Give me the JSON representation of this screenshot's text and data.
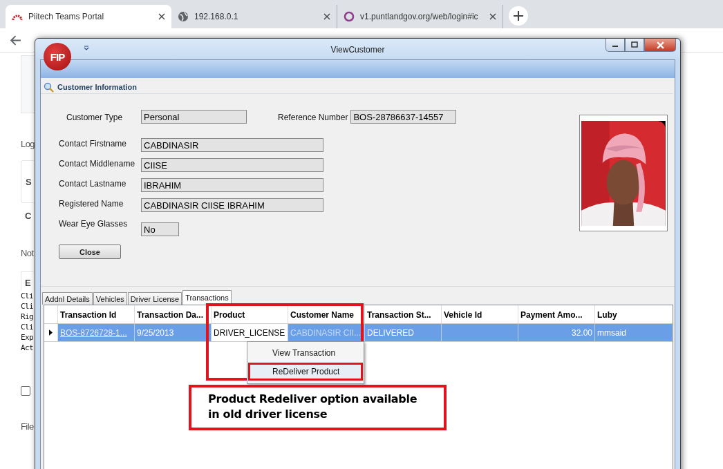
{
  "browser": {
    "tabs": [
      {
        "title": "Piitech Teams Portal",
        "selected": true
      },
      {
        "title": "192.168.0.1",
        "selected": false
      },
      {
        "title": "v1.puntlandgov.org/web/login#ic",
        "selected": false
      }
    ]
  },
  "background_page": {
    "lines": [
      {
        "kind": "panel"
      },
      {
        "kind": "plain",
        "text": "Log"
      },
      {
        "kind": "card",
        "text": "S"
      },
      {
        "kind": "bold",
        "text": "C"
      },
      {
        "kind": "plain",
        "text": "Not"
      },
      {
        "kind": "tab",
        "text": "E"
      },
      {
        "kind": "code",
        "text": "Cli"
      },
      {
        "kind": "code",
        "text": "Cli"
      },
      {
        "kind": "code",
        "text": "Rig"
      },
      {
        "kind": "code",
        "text": "Cli"
      },
      {
        "kind": "code",
        "text": "Exp"
      },
      {
        "kind": "code",
        "text": "Act"
      },
      {
        "kind": "checkbox",
        "checked": false
      },
      {
        "kind": "plain",
        "text": "File"
      }
    ]
  },
  "window": {
    "title": "ViewCustomer",
    "logo": "FIP"
  },
  "customer_information": {
    "title": "Customer Information",
    "rows": [
      [
        {
          "label": "Customer Type",
          "value": "Personal",
          "kind": "medium"
        },
        {
          "label": "Reference Number",
          "value": "BOS-28786637-14557",
          "kind": "medium"
        }
      ],
      [
        {
          "label": "Contact Firstname",
          "value": "CABDINASIR",
          "kind": "wide"
        }
      ],
      [
        {
          "label": "Contact Middlename",
          "value": "CIISE",
          "kind": "wide"
        }
      ],
      [
        {
          "label": "Contact Lastname",
          "value": "IBRAHIM",
          "kind": "wide"
        }
      ],
      [
        {
          "label": "Registered Name",
          "value": "CABDINASIR CIISE IBRAHIM",
          "kind": "wide"
        }
      ],
      [
        {
          "label": "Wear Eye Glasses",
          "value": "No",
          "kind": "narrow"
        }
      ]
    ],
    "close_button": "Close"
  },
  "tabs": [
    {
      "label": "Addnl Details",
      "selected": false
    },
    {
      "label": "Vehicles",
      "selected": false
    },
    {
      "label": "Driver License",
      "selected": false
    },
    {
      "label": "Transactions",
      "selected": true
    }
  ],
  "table": {
    "columns": [
      "Transaction Id",
      "Transaction Da...",
      "Product",
      "Customer Name",
      "Transaction St...",
      "Vehicle Id",
      "Payment Amo...",
      "Luby"
    ],
    "rows": [
      {
        "selected": true,
        "cells": [
          {
            "text": "BOS-8726728-1...",
            "kind": "link"
          },
          {
            "text": "9/25/2013",
            "kind": "plain"
          },
          {
            "text": "DRIVER_LICENSE",
            "kind": "current"
          },
          {
            "text": "CABDINASIR CII...",
            "kind": "muted"
          },
          {
            "text": "DELIVERED",
            "kind": "plain"
          },
          {
            "kind": "empty"
          },
          {
            "text": "32.00",
            "kind": "number"
          },
          {
            "text": "mmsaid",
            "kind": "plain"
          }
        ]
      }
    ]
  },
  "context_menu": [
    {
      "label": "View Transaction",
      "highlighted": false
    },
    {
      "label": "ReDeliver Product",
      "highlighted": true
    }
  ],
  "annotation": {
    "text": "Product Redeliver option available in old driver license"
  }
}
